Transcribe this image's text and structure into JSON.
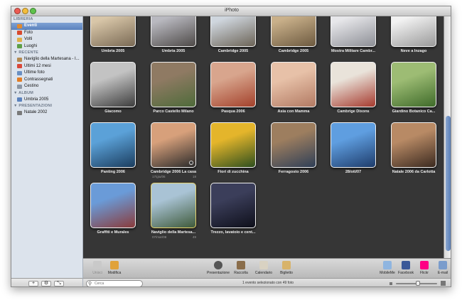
{
  "window": {
    "title": "iPhoto"
  },
  "colors": {
    "selection": "#5b82bd",
    "grid_bg": "#363636",
    "accent_selected_thumb": "#e7d36c"
  },
  "sidebar": {
    "sections": [
      {
        "header": "LIBRERIA",
        "items": [
          {
            "label": "Eventi",
            "icon": "events-icon",
            "selected": true
          },
          {
            "label": "Foto",
            "icon": "photos-icon",
            "selected": false
          },
          {
            "label": "Volti",
            "icon": "faces-icon",
            "selected": false
          },
          {
            "label": "Luoghi",
            "icon": "places-icon",
            "selected": false
          }
        ]
      },
      {
        "header": "▼ RECENTE",
        "items": [
          {
            "label": "Naviglio della Martesana - I...",
            "icon": "event-icon",
            "selected": false
          },
          {
            "label": "Ultimi 12 mesi",
            "icon": "calendar-icon",
            "selected": false
          },
          {
            "label": "Ultime foto",
            "icon": "last-import-icon",
            "selected": false
          },
          {
            "label": "Contrassegnati",
            "icon": "flag-icon",
            "selected": false
          },
          {
            "label": "Cestino",
            "icon": "trash-icon",
            "selected": false
          }
        ]
      },
      {
        "header": "▼ ALBUM",
        "items": [
          {
            "label": "Umbria 2005",
            "icon": "album-icon",
            "selected": false
          }
        ]
      },
      {
        "header": "▼ PRESENTAZIONI",
        "items": [
          {
            "label": "Natale 2002",
            "icon": "slideshow-icon",
            "selected": false
          }
        ]
      }
    ],
    "bottom_buttons": [
      {
        "label": "+",
        "icon": "add-icon"
      },
      {
        "label": "⚙",
        "icon": "gear-icon"
      },
      {
        "label": "⤡",
        "icon": "fullscreen-icon"
      }
    ]
  },
  "events": [
    {
      "name": "Umbria 2005",
      "c1": "#d8c6a8",
      "c2": "#7a6a55"
    },
    {
      "name": "Umbria 2005",
      "c1": "#b9b9c0",
      "c2": "#4e4a48"
    },
    {
      "name": "Cambridge 2005",
      "c1": "#cfd6de",
      "c2": "#6c6457"
    },
    {
      "name": "Cambridge 2005",
      "c1": "#c9b08a",
      "c2": "#6d5a40"
    },
    {
      "name": "Mostra Militare Cambr...",
      "c1": "#e7e7ea",
      "c2": "#8d8f96"
    },
    {
      "name": "Neve a Inzago",
      "c1": "#f2f2f2",
      "c2": "#9a9a9a"
    },
    {
      "name": "Giacomo",
      "c1": "#c3c3c3",
      "c2": "#3d3d3d"
    },
    {
      "name": "Parco Castello Milano",
      "c1": "#8f7a63",
      "c2": "#4e6b3a"
    },
    {
      "name": "Pasqua 2006",
      "c1": "#d8a58d",
      "c2": "#a3412b"
    },
    {
      "name": "Asia con Mamma",
      "c1": "#e7c1a8",
      "c2": "#b27a63"
    },
    {
      "name": "Cambrige Dixons",
      "c1": "#e9e3da",
      "c2": "#a63a2e"
    },
    {
      "name": "Giardino Botanico Ca...",
      "c1": "#9dbc74",
      "c2": "#3f6b2a"
    },
    {
      "name": "Panting 2006",
      "c1": "#5ba1d8",
      "c2": "#1b3d5e"
    },
    {
      "name": "Cambridge 2006 La casa",
      "c1": "#d7a07b",
      "c2": "#2a2a2a",
      "sub_left": "17/giu/06",
      "sub_right": "18",
      "badge": "i"
    },
    {
      "name": "Fiori di zucchina",
      "c1": "#e4b52b",
      "c2": "#2e4f1e"
    },
    {
      "name": "Ferragosto 2006",
      "c1": "#9d7e5f",
      "c2": "#2f3f57"
    },
    {
      "name": "28/ott/07",
      "c1": "#5f9ee0",
      "c2": "#1e3c6b"
    },
    {
      "name": "Natale 2006 da Carlotta",
      "c1": "#b88a65",
      "c2": "#3b2a20"
    },
    {
      "name": "Graffiti e Murales",
      "c1": "#6a9bd8",
      "c2": "#8a3b3b"
    },
    {
      "name": "Naviglio della Martesa...",
      "c1": "#a9c3d5",
      "c2": "#3f5a3a",
      "selected": true,
      "sub_left": "07/mar/08",
      "sub_right": "49"
    },
    {
      "name": "Trezzo, lavatoio e cent...",
      "c1": "#3b3e5a",
      "c2": "#0e0f1a"
    }
  ],
  "toolbar": {
    "left": [
      {
        "label": "Unisci",
        "icon": "merge-icon",
        "disabled": true
      },
      {
        "label": "Modifica",
        "icon": "edit-pencil-icon",
        "disabled": false
      }
    ],
    "center": [
      {
        "label": "Presentazione",
        "icon": "play-icon"
      },
      {
        "label": "Raccolta",
        "icon": "book-icon"
      },
      {
        "label": "Calendario",
        "icon": "calendar-icon"
      },
      {
        "label": "Biglietto",
        "icon": "card-icon"
      }
    ],
    "right": [
      {
        "label": "MobileMe",
        "icon": "mobileme-icon"
      },
      {
        "label": "Facebook",
        "icon": "facebook-icon"
      },
      {
        "label": "Flickr",
        "icon": "flickr-icon"
      },
      {
        "label": "E-mail",
        "icon": "mail-icon"
      }
    ]
  },
  "status": {
    "search_placeholder": "Cerca",
    "text": "1 evento selezionato con 49 foto"
  }
}
